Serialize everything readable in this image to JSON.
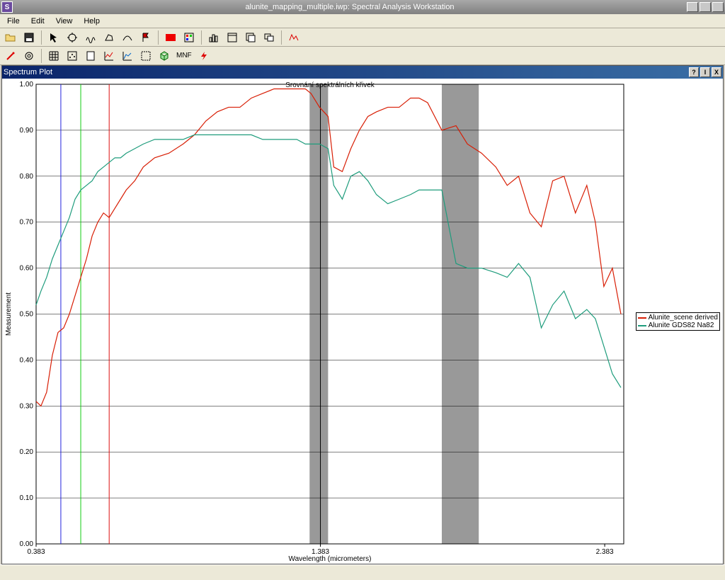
{
  "window": {
    "title": "alunite_mapping_multiple.iwp: Spectral Analysis Workstation",
    "app_icon_glyph": "S"
  },
  "menu": {
    "file": "File",
    "edit": "Edit",
    "view": "View",
    "help": "Help"
  },
  "subwindow": {
    "title": "Spectrum Plot",
    "help_btn": "?",
    "min_btn": "I",
    "close_btn": "X"
  },
  "chart_annotation": "Srovnání spektrálních křivek",
  "legend": {
    "series1": {
      "color": "#d81e05",
      "label": "Alunite_scene derived"
    },
    "series2": {
      "color": "#1e9c7c",
      "label": "Alunite GDS82 Na82"
    }
  },
  "axes": {
    "xlabel": "Wavelength (micrometers)",
    "ylabel": "Measurement",
    "xmin": 0.383,
    "xmax": 2.45,
    "xlabmax": 2.383,
    "ymin": 0.0,
    "ymax": 1.0,
    "yticks": [
      0.0,
      0.1,
      0.2,
      0.3,
      0.4,
      0.5,
      0.6,
      0.7,
      0.8,
      0.9,
      1.0
    ],
    "xticks": [
      0.383,
      1.383,
      2.383
    ]
  },
  "bands": [
    {
      "x0": 1.345,
      "x1": 1.41,
      "color": "#999999"
    },
    {
      "x0": 1.81,
      "x1": 1.94,
      "color": "#999999"
    }
  ],
  "markers": [
    {
      "x": 0.47,
      "color": "#2222dd"
    },
    {
      "x": 0.54,
      "color": "#11cc11"
    },
    {
      "x": 0.64,
      "color": "#dd1111"
    }
  ],
  "toolbar_mnf_label": "MNF",
  "chart_data": {
    "type": "line",
    "title": "Srovnání spektrálních křivek",
    "xlabel": "Wavelength (micrometers)",
    "ylabel": "Measurement",
    "xlim": [
      0.383,
      2.45
    ],
    "ylim": [
      0.0,
      1.0
    ],
    "series": [
      {
        "name": "Alunite_scene derived",
        "color": "#d81e05",
        "x": [
          0.383,
          0.4,
          0.42,
          0.44,
          0.46,
          0.48,
          0.5,
          0.52,
          0.54,
          0.56,
          0.58,
          0.6,
          0.62,
          0.64,
          0.66,
          0.68,
          0.7,
          0.73,
          0.76,
          0.8,
          0.85,
          0.9,
          0.94,
          0.98,
          1.02,
          1.06,
          1.1,
          1.14,
          1.18,
          1.22,
          1.26,
          1.3,
          1.33,
          1.35,
          1.38,
          1.41,
          1.43,
          1.46,
          1.49,
          1.52,
          1.55,
          1.58,
          1.62,
          1.66,
          1.7,
          1.73,
          1.76,
          1.81,
          1.86,
          1.9,
          1.95,
          2.0,
          2.04,
          2.08,
          2.12,
          2.16,
          2.2,
          2.24,
          2.28,
          2.32,
          2.35,
          2.38,
          2.41,
          2.44
        ],
        "values": [
          0.31,
          0.3,
          0.33,
          0.41,
          0.46,
          0.47,
          0.5,
          0.54,
          0.58,
          0.62,
          0.67,
          0.7,
          0.72,
          0.71,
          0.73,
          0.75,
          0.77,
          0.79,
          0.82,
          0.84,
          0.85,
          0.87,
          0.89,
          0.92,
          0.94,
          0.95,
          0.95,
          0.97,
          0.98,
          0.99,
          0.99,
          0.99,
          0.99,
          0.98,
          0.95,
          0.93,
          0.82,
          0.81,
          0.86,
          0.9,
          0.93,
          0.94,
          0.95,
          0.95,
          0.97,
          0.97,
          0.96,
          0.9,
          0.91,
          0.87,
          0.85,
          0.82,
          0.78,
          0.8,
          0.72,
          0.69,
          0.79,
          0.8,
          0.72,
          0.78,
          0.7,
          0.56,
          0.6,
          0.5
        ]
      },
      {
        "name": "Alunite GDS82 Na82",
        "color": "#1e9c7c",
        "x": [
          0.383,
          0.4,
          0.42,
          0.44,
          0.46,
          0.48,
          0.5,
          0.52,
          0.54,
          0.56,
          0.58,
          0.6,
          0.62,
          0.64,
          0.66,
          0.68,
          0.7,
          0.73,
          0.76,
          0.8,
          0.85,
          0.9,
          0.94,
          0.98,
          1.02,
          1.06,
          1.1,
          1.14,
          1.18,
          1.22,
          1.26,
          1.3,
          1.33,
          1.35,
          1.38,
          1.41,
          1.43,
          1.46,
          1.49,
          1.52,
          1.55,
          1.58,
          1.62,
          1.66,
          1.7,
          1.73,
          1.76,
          1.81,
          1.86,
          1.9,
          1.95,
          2.0,
          2.04,
          2.08,
          2.12,
          2.16,
          2.2,
          2.24,
          2.28,
          2.32,
          2.35,
          2.38,
          2.41,
          2.44
        ],
        "values": [
          0.52,
          0.55,
          0.58,
          0.62,
          0.65,
          0.68,
          0.71,
          0.75,
          0.77,
          0.78,
          0.79,
          0.81,
          0.82,
          0.83,
          0.84,
          0.84,
          0.85,
          0.86,
          0.87,
          0.88,
          0.88,
          0.88,
          0.89,
          0.89,
          0.89,
          0.89,
          0.89,
          0.89,
          0.88,
          0.88,
          0.88,
          0.88,
          0.87,
          0.87,
          0.87,
          0.86,
          0.78,
          0.75,
          0.8,
          0.81,
          0.79,
          0.76,
          0.74,
          0.75,
          0.76,
          0.77,
          0.77,
          0.77,
          0.61,
          0.6,
          0.6,
          0.59,
          0.58,
          0.61,
          0.58,
          0.47,
          0.52,
          0.55,
          0.49,
          0.51,
          0.49,
          0.43,
          0.37,
          0.34
        ]
      }
    ]
  }
}
